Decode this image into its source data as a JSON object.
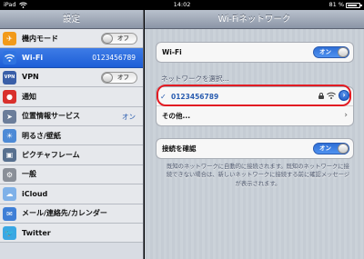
{
  "statusbar": {
    "device": "iPad",
    "time": "14:02",
    "battery": "81 %",
    "battery_level": 0.81
  },
  "left": {
    "title": "設定",
    "items": [
      {
        "label": "機内モード",
        "icon": "airplane-icon",
        "icon_color": "#f29a1a",
        "toggle": "オフ"
      },
      {
        "label": "Wi-Fi",
        "icon": "wifi-icon",
        "icon_color": "#2f73e0",
        "value": "0123456789",
        "selected": true
      },
      {
        "label": "VPN",
        "icon": "vpn-icon",
        "icon_color": "#3a5fa8",
        "toggle": "オフ"
      },
      {
        "label": "通知",
        "icon": "notification-icon",
        "icon_color": "#d9302c"
      },
      {
        "label": "位置情報サービス",
        "icon": "location-icon",
        "icon_color": "#6b7d9a",
        "value": "オン"
      },
      {
        "label": "明るさ/壁紙",
        "icon": "brightness-icon",
        "icon_color": "#4d8ad6"
      },
      {
        "label": "ピクチャフレーム",
        "icon": "picture-frame-icon",
        "icon_color": "#58708f"
      },
      {
        "label": "一般",
        "icon": "gear-icon",
        "icon_color": "#8a8f98"
      },
      {
        "label": "iCloud",
        "icon": "cloud-icon",
        "icon_color": "#7fb1e8"
      },
      {
        "label": "メール/連絡先/カレンダー",
        "icon": "mail-icon",
        "icon_color": "#3f7fd6"
      },
      {
        "label": "Twitter",
        "icon": "twitter-icon",
        "icon_color": "#3aa7e3"
      }
    ]
  },
  "right": {
    "title": "Wi-Fiネットワーク",
    "wifi": {
      "label": "Wi-Fi",
      "toggle": "オン"
    },
    "choose_label": "ネットワークを選択...",
    "network": {
      "check": "✓",
      "name": "0123456789"
    },
    "other_label": "その他...",
    "ask": {
      "label": "接続を確認",
      "toggle": "オン"
    },
    "footnote": "既知のネットワークに自動的に接続されます。既知のネットワークに接続できない場合は、新しいネットワークに接続する前に確認メッセージが表示されます。"
  },
  "colors": {
    "accent": "#2a5db0",
    "highlight": "#e21b23",
    "selected": "#1d5ed7"
  }
}
